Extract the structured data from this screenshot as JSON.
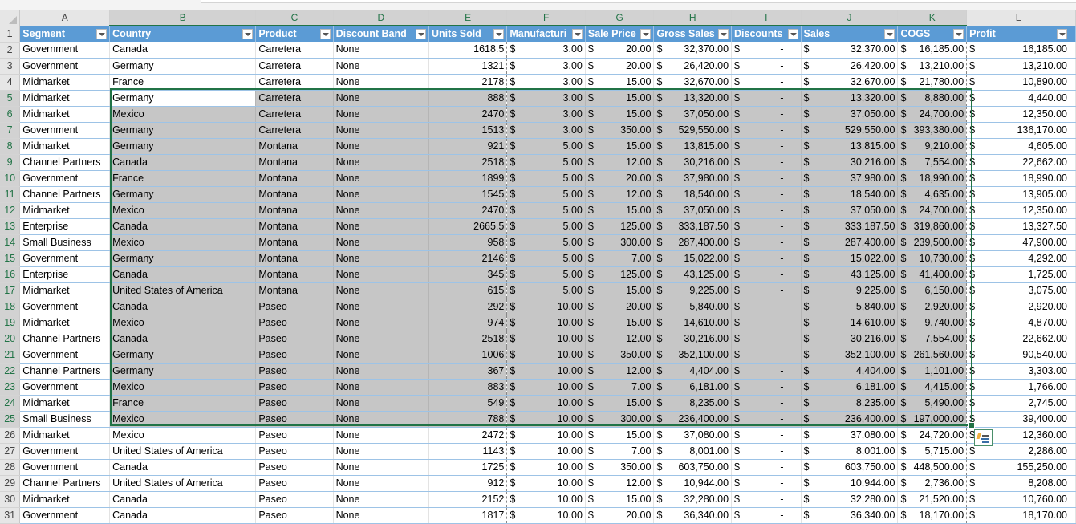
{
  "column_letters": [
    "A",
    "B",
    "C",
    "D",
    "E",
    "F",
    "G",
    "H",
    "I",
    "J",
    "K",
    "L"
  ],
  "headers": [
    "Segment",
    "Country",
    "Product",
    "Discount Band",
    "Units Sold",
    "Manufacturi",
    "Sale Price",
    "Gross Sales",
    "Discounts",
    "Sales",
    "COGS",
    "Profit"
  ],
  "rows": [
    {
      "n": "2",
      "seg": "Government",
      "country": "Canada",
      "product": "Carretera",
      "band": "None",
      "units": "1618.5",
      "mfg": "3.00",
      "price": "20.00",
      "gross": "32,370.00",
      "disc": "-",
      "sales": "32,370.00",
      "cogs": "16,185.00",
      "profit": "16,185.00"
    },
    {
      "n": "3",
      "seg": "Government",
      "country": "Germany",
      "product": "Carretera",
      "band": "None",
      "units": "1321",
      "mfg": "3.00",
      "price": "20.00",
      "gross": "26,420.00",
      "disc": "-",
      "sales": "26,420.00",
      "cogs": "13,210.00",
      "profit": "13,210.00"
    },
    {
      "n": "4",
      "seg": "Midmarket",
      "country": "France",
      "product": "Carretera",
      "band": "None",
      "units": "2178",
      "mfg": "3.00",
      "price": "15.00",
      "gross": "32,670.00",
      "disc": "-",
      "sales": "32,670.00",
      "cogs": "21,780.00",
      "profit": "10,890.00"
    },
    {
      "n": "5",
      "seg": "Midmarket",
      "country": "Germany",
      "product": "Carretera",
      "band": "None",
      "units": "888",
      "mfg": "3.00",
      "price": "15.00",
      "gross": "13,320.00",
      "disc": "-",
      "sales": "13,320.00",
      "cogs": "8,880.00",
      "profit": "4,440.00"
    },
    {
      "n": "6",
      "seg": "Midmarket",
      "country": "Mexico",
      "product": "Carretera",
      "band": "None",
      "units": "2470",
      "mfg": "3.00",
      "price": "15.00",
      "gross": "37,050.00",
      "disc": "-",
      "sales": "37,050.00",
      "cogs": "24,700.00",
      "profit": "12,350.00"
    },
    {
      "n": "7",
      "seg": "Government",
      "country": "Germany",
      "product": "Carretera",
      "band": "None",
      "units": "1513",
      "mfg": "3.00",
      "price": "350.00",
      "gross": "529,550.00",
      "disc": "-",
      "sales": "529,550.00",
      "cogs": "393,380.00",
      "profit": "136,170.00"
    },
    {
      "n": "8",
      "seg": "Midmarket",
      "country": "Germany",
      "product": "Montana",
      "band": "None",
      "units": "921",
      "mfg": "5.00",
      "price": "15.00",
      "gross": "13,815.00",
      "disc": "-",
      "sales": "13,815.00",
      "cogs": "9,210.00",
      "profit": "4,605.00"
    },
    {
      "n": "9",
      "seg": "Channel Partners",
      "country": "Canada",
      "product": "Montana",
      "band": "None",
      "units": "2518",
      "mfg": "5.00",
      "price": "12.00",
      "gross": "30,216.00",
      "disc": "-",
      "sales": "30,216.00",
      "cogs": "7,554.00",
      "profit": "22,662.00"
    },
    {
      "n": "10",
      "seg": "Government",
      "country": "France",
      "product": "Montana",
      "band": "None",
      "units": "1899",
      "mfg": "5.00",
      "price": "20.00",
      "gross": "37,980.00",
      "disc": "-",
      "sales": "37,980.00",
      "cogs": "18,990.00",
      "profit": "18,990.00"
    },
    {
      "n": "11",
      "seg": "Channel Partners",
      "country": "Germany",
      "product": "Montana",
      "band": "None",
      "units": "1545",
      "mfg": "5.00",
      "price": "12.00",
      "gross": "18,540.00",
      "disc": "-",
      "sales": "18,540.00",
      "cogs": "4,635.00",
      "profit": "13,905.00"
    },
    {
      "n": "12",
      "seg": "Midmarket",
      "country": "Mexico",
      "product": "Montana",
      "band": "None",
      "units": "2470",
      "mfg": "5.00",
      "price": "15.00",
      "gross": "37,050.00",
      "disc": "-",
      "sales": "37,050.00",
      "cogs": "24,700.00",
      "profit": "12,350.00"
    },
    {
      "n": "13",
      "seg": "Enterprise",
      "country": "Canada",
      "product": "Montana",
      "band": "None",
      "units": "2665.5",
      "mfg": "5.00",
      "price": "125.00",
      "gross": "333,187.50",
      "disc": "-",
      "sales": "333,187.50",
      "cogs": "319,860.00",
      "profit": "13,327.50"
    },
    {
      "n": "14",
      "seg": "Small Business",
      "country": "Mexico",
      "product": "Montana",
      "band": "None",
      "units": "958",
      "mfg": "5.00",
      "price": "300.00",
      "gross": "287,400.00",
      "disc": "-",
      "sales": "287,400.00",
      "cogs": "239,500.00",
      "profit": "47,900.00"
    },
    {
      "n": "15",
      "seg": "Government",
      "country": "Germany",
      "product": "Montana",
      "band": "None",
      "units": "2146",
      "mfg": "5.00",
      "price": "7.00",
      "gross": "15,022.00",
      "disc": "-",
      "sales": "15,022.00",
      "cogs": "10,730.00",
      "profit": "4,292.00"
    },
    {
      "n": "16",
      "seg": "Enterprise",
      "country": "Canada",
      "product": "Montana",
      "band": "None",
      "units": "345",
      "mfg": "5.00",
      "price": "125.00",
      "gross": "43,125.00",
      "disc": "-",
      "sales": "43,125.00",
      "cogs": "41,400.00",
      "profit": "1,725.00"
    },
    {
      "n": "17",
      "seg": "Midmarket",
      "country": "United States of America",
      "product": "Montana",
      "band": "None",
      "units": "615",
      "mfg": "5.00",
      "price": "15.00",
      "gross": "9,225.00",
      "disc": "-",
      "sales": "9,225.00",
      "cogs": "6,150.00",
      "profit": "3,075.00"
    },
    {
      "n": "18",
      "seg": "Government",
      "country": "Canada",
      "product": "Paseo",
      "band": "None",
      "units": "292",
      "mfg": "10.00",
      "price": "20.00",
      "gross": "5,840.00",
      "disc": "-",
      "sales": "5,840.00",
      "cogs": "2,920.00",
      "profit": "2,920.00"
    },
    {
      "n": "19",
      "seg": "Midmarket",
      "country": "Mexico",
      "product": "Paseo",
      "band": "None",
      "units": "974",
      "mfg": "10.00",
      "price": "15.00",
      "gross": "14,610.00",
      "disc": "-",
      "sales": "14,610.00",
      "cogs": "9,740.00",
      "profit": "4,870.00"
    },
    {
      "n": "20",
      "seg": "Channel Partners",
      "country": "Canada",
      "product": "Paseo",
      "band": "None",
      "units": "2518",
      "mfg": "10.00",
      "price": "12.00",
      "gross": "30,216.00",
      "disc": "-",
      "sales": "30,216.00",
      "cogs": "7,554.00",
      "profit": "22,662.00"
    },
    {
      "n": "21",
      "seg": "Government",
      "country": "Germany",
      "product": "Paseo",
      "band": "None",
      "units": "1006",
      "mfg": "10.00",
      "price": "350.00",
      "gross": "352,100.00",
      "disc": "-",
      "sales": "352,100.00",
      "cogs": "261,560.00",
      "profit": "90,540.00"
    },
    {
      "n": "22",
      "seg": "Channel Partners",
      "country": "Germany",
      "product": "Paseo",
      "band": "None",
      "units": "367",
      "mfg": "10.00",
      "price": "12.00",
      "gross": "4,404.00",
      "disc": "-",
      "sales": "4,404.00",
      "cogs": "1,101.00",
      "profit": "3,303.00"
    },
    {
      "n": "23",
      "seg": "Government",
      "country": "Mexico",
      "product": "Paseo",
      "band": "None",
      "units": "883",
      "mfg": "10.00",
      "price": "7.00",
      "gross": "6,181.00",
      "disc": "-",
      "sales": "6,181.00",
      "cogs": "4,415.00",
      "profit": "1,766.00"
    },
    {
      "n": "24",
      "seg": "Midmarket",
      "country": "France",
      "product": "Paseo",
      "band": "None",
      "units": "549",
      "mfg": "10.00",
      "price": "15.00",
      "gross": "8,235.00",
      "disc": "-",
      "sales": "8,235.00",
      "cogs": "5,490.00",
      "profit": "2,745.00"
    },
    {
      "n": "25",
      "seg": "Small Business",
      "country": "Mexico",
      "product": "Paseo",
      "band": "None",
      "units": "788",
      "mfg": "10.00",
      "price": "300.00",
      "gross": "236,400.00",
      "disc": "-",
      "sales": "236,400.00",
      "cogs": "197,000.00",
      "profit": "39,400.00"
    },
    {
      "n": "26",
      "seg": "Midmarket",
      "country": "Mexico",
      "product": "Paseo",
      "band": "None",
      "units": "2472",
      "mfg": "10.00",
      "price": "15.00",
      "gross": "37,080.00",
      "disc": "-",
      "sales": "37,080.00",
      "cogs": "24,720.00",
      "profit": "12,360.00"
    },
    {
      "n": "27",
      "seg": "Government",
      "country": "United States of America",
      "product": "Paseo",
      "band": "None",
      "units": "1143",
      "mfg": "10.00",
      "price": "7.00",
      "gross": "8,001.00",
      "disc": "-",
      "sales": "8,001.00",
      "cogs": "5,715.00",
      "profit": "2,286.00"
    },
    {
      "n": "28",
      "seg": "Government",
      "country": "Canada",
      "product": "Paseo",
      "band": "None",
      "units": "1725",
      "mfg": "10.00",
      "price": "350.00",
      "gross": "603,750.00",
      "disc": "-",
      "sales": "603,750.00",
      "cogs": "448,500.00",
      "profit": "155,250.00"
    },
    {
      "n": "29",
      "seg": "Channel Partners",
      "country": "United States of America",
      "product": "Paseo",
      "band": "None",
      "units": "912",
      "mfg": "10.00",
      "price": "12.00",
      "gross": "10,944.00",
      "disc": "-",
      "sales": "10,944.00",
      "cogs": "2,736.00",
      "profit": "8,208.00"
    },
    {
      "n": "30",
      "seg": "Midmarket",
      "country": "Canada",
      "product": "Paseo",
      "band": "None",
      "units": "2152",
      "mfg": "10.00",
      "price": "15.00",
      "gross": "32,280.00",
      "disc": "-",
      "sales": "32,280.00",
      "cogs": "21,520.00",
      "profit": "10,760.00"
    },
    {
      "n": "31",
      "seg": "Government",
      "country": "Canada",
      "product": "Paseo",
      "band": "None",
      "units": "1817",
      "mfg": "10.00",
      "price": "20.00",
      "gross": "36,340.00",
      "disc": "-",
      "sales": "36,340.00",
      "cogs": "18,170.00",
      "profit": "18,170.00"
    }
  ],
  "currency_symbol": "$",
  "header_row_number": "1",
  "selection": {
    "range": "B5:K25",
    "active_cell": "B5"
  },
  "quick_analysis_icon": "quick-analysis-icon",
  "colors": {
    "table_header": "#5b9bd5",
    "selection_border": "#217346",
    "selection_fill": "#c6c6c6",
    "row_band_border": "#9dc3e6"
  }
}
